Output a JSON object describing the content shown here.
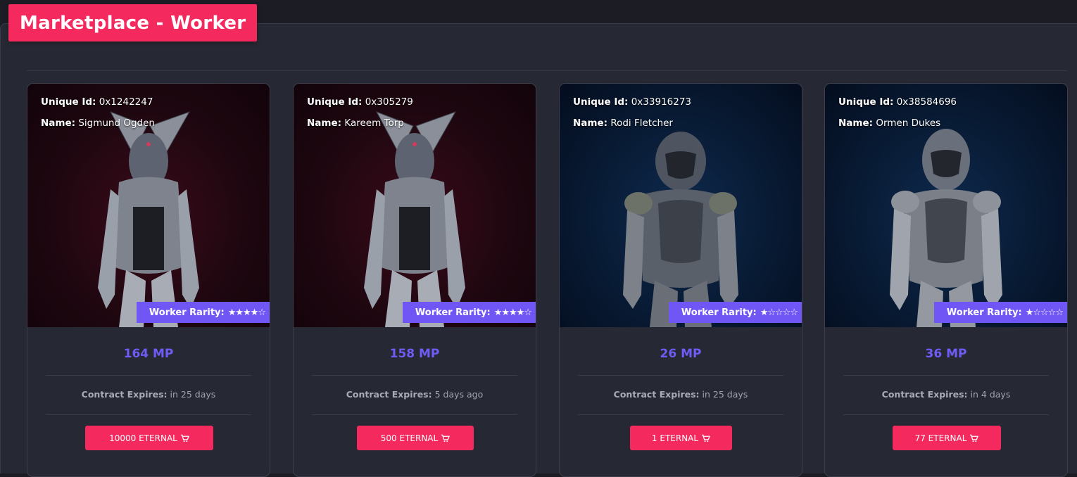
{
  "page": {
    "title": "Marketplace - Worker"
  },
  "labels": {
    "unique_id": "Unique Id:",
    "name": "Name:",
    "rarity": "Worker Rarity:",
    "contract_expires": "Contract Expires:"
  },
  "colors": {
    "accent": "#f42a5e",
    "rarity_badge": "#6f56f5",
    "price": "#6f5cf6",
    "background": "#262933"
  },
  "cards": [
    {
      "unique_id": "0x1242247",
      "name": "Sigmund Ogden",
      "rarity_stars": "★★★★☆",
      "rarity_level": 4,
      "rarity_max": 5,
      "price": "164 MP",
      "expires": "in 25 days",
      "buy_label": "10000 ETERNAL",
      "theme": "red"
    },
    {
      "unique_id": "0x305279",
      "name": "Kareem Torp",
      "rarity_stars": "★★★★☆",
      "rarity_level": 4,
      "rarity_max": 5,
      "price": "158 MP",
      "expires": "5 days ago",
      "buy_label": "500 ETERNAL",
      "theme": "red"
    },
    {
      "unique_id": "0x33916273",
      "name": "Rodi Fletcher",
      "rarity_stars": "★☆☆☆☆",
      "rarity_level": 1,
      "rarity_max": 5,
      "price": "26 MP",
      "expires": "in 25 days",
      "buy_label": "1 ETERNAL",
      "theme": "blue"
    },
    {
      "unique_id": "0x38584696",
      "name": "Ormen Dukes",
      "rarity_stars": "★☆☆☆☆",
      "rarity_level": 1,
      "rarity_max": 5,
      "price": "36 MP",
      "expires": "in 4 days",
      "buy_label": "77 ETERNAL",
      "theme": "blue"
    }
  ],
  "icons": {
    "cart": "shopping-cart-icon",
    "worker": "worker-armor-figure"
  }
}
